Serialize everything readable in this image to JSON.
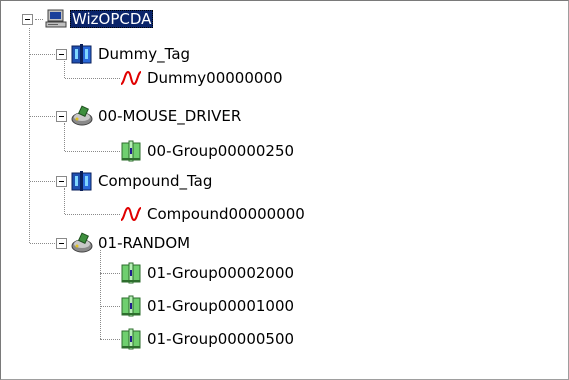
{
  "tree": {
    "root": {
      "label": "WizOPCDA",
      "icon": "computer-icon",
      "selected": true
    },
    "nodes": [
      {
        "label": "Dummy_Tag",
        "icon": "book-icon"
      },
      {
        "label": "Dummy00000000",
        "icon": "signal-wave-icon"
      },
      {
        "label": "00-MOUSE_DRIVER",
        "icon": "driver-icon"
      },
      {
        "label": "00-Group00000250",
        "icon": "group-folder-icon"
      },
      {
        "label": "Compound_Tag",
        "icon": "book-icon"
      },
      {
        "label": "Compound00000000",
        "icon": "signal-wave-icon"
      },
      {
        "label": "01-RANDOM",
        "icon": "driver-icon"
      },
      {
        "label": "01-Group00002000",
        "icon": "group-folder-icon"
      },
      {
        "label": "01-Group00001000",
        "icon": "group-folder-icon"
      },
      {
        "label": "01-Group00000500",
        "icon": "group-folder-icon"
      }
    ],
    "colors": {
      "selection": "#0a246a",
      "wave": "#e00000",
      "connector": "#8a8a8a"
    }
  }
}
